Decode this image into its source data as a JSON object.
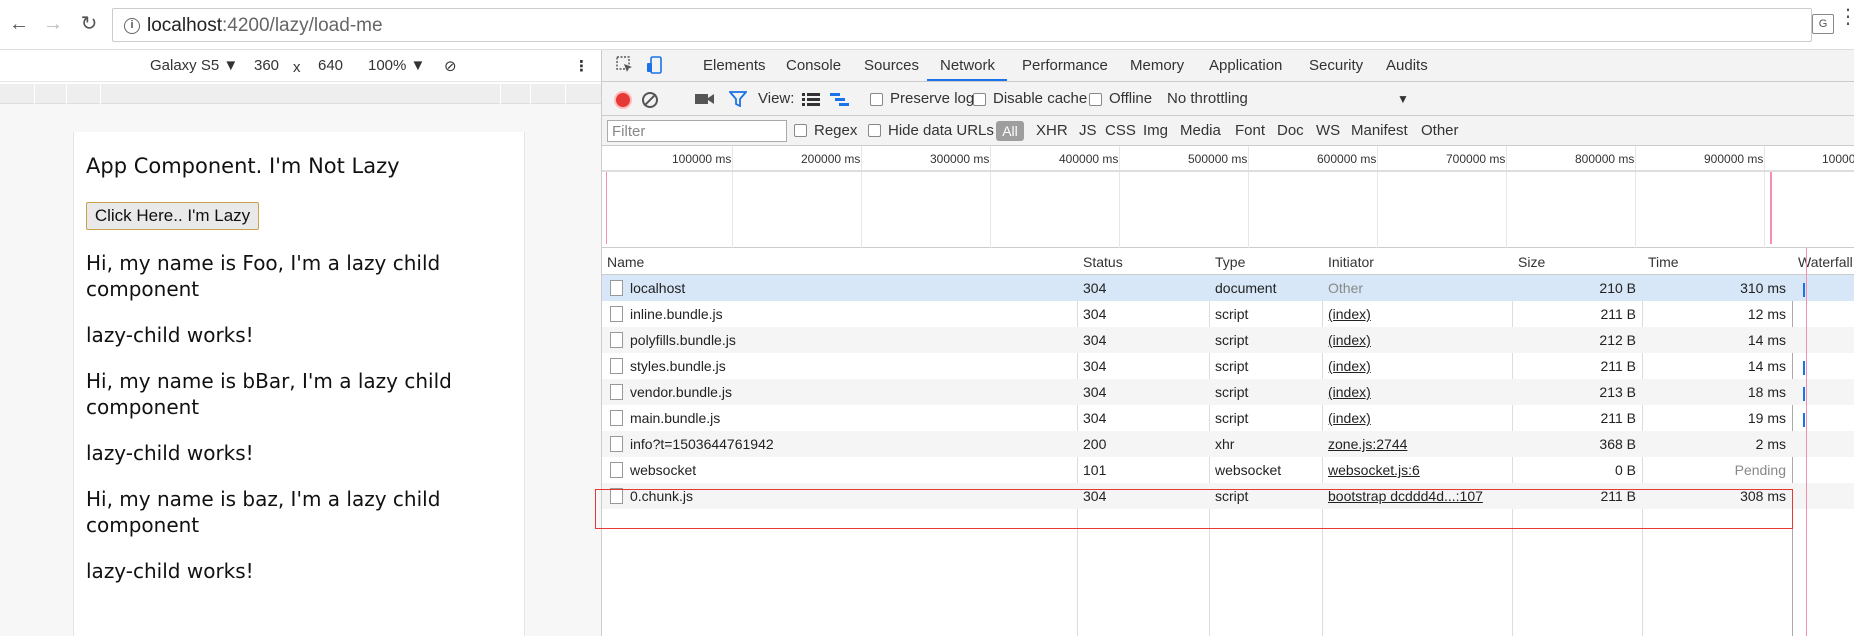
{
  "browser": {
    "url_host": "localhost",
    "url_rest": ":4200/lazy/load-me"
  },
  "device_toolbar": {
    "device": "Galaxy S5",
    "width": "360",
    "times": "x",
    "height": "640",
    "zoom": "100%"
  },
  "app": {
    "title": "App Component. I'm Not Lazy",
    "button_label": "Click Here.. I'm Lazy",
    "paragraphs": [
      "Hi, my name is Foo, I'm a lazy child component",
      "lazy-child works!",
      "Hi, my name is bBar, I'm a lazy child component",
      "lazy-child works!",
      "Hi, my name is baz, I'm a lazy child component",
      "lazy-child works!"
    ]
  },
  "devtools": {
    "tabs": [
      "Elements",
      "Console",
      "Sources",
      "Network",
      "Performance",
      "Memory",
      "Application",
      "Security",
      "Audits"
    ],
    "active_tab": "Network",
    "toolbar": {
      "view_label": "View:",
      "preserve_log": "Preserve log",
      "disable_cache": "Disable cache",
      "offline": "Offline",
      "throttling": "No throttling"
    },
    "filter": {
      "placeholder": "Filter",
      "regex": "Regex",
      "hide_data_urls": "Hide data URLs",
      "all": "All",
      "types": [
        "XHR",
        "JS",
        "CSS",
        "Img",
        "Media",
        "Font",
        "Doc",
        "WS",
        "Manifest",
        "Other"
      ]
    },
    "timeline_labels": [
      "100000 ms",
      "200000 ms",
      "300000 ms",
      "400000 ms",
      "500000 ms",
      "600000 ms",
      "700000 ms",
      "800000 ms",
      "900000 ms",
      "10000"
    ],
    "columns": [
      "Name",
      "Status",
      "Type",
      "Initiator",
      "Size",
      "Time",
      "Waterfall"
    ],
    "rows": [
      {
        "name": "localhost",
        "status": "304",
        "type": "document",
        "initiator": "Other",
        "size": "210 B",
        "time": "310 ms"
      },
      {
        "name": "inline.bundle.js",
        "status": "304",
        "type": "script",
        "initiator": "(index)",
        "size": "211 B",
        "time": "12 ms"
      },
      {
        "name": "polyfills.bundle.js",
        "status": "304",
        "type": "script",
        "initiator": "(index)",
        "size": "212 B",
        "time": "14 ms"
      },
      {
        "name": "styles.bundle.js",
        "status": "304",
        "type": "script",
        "initiator": "(index)",
        "size": "211 B",
        "time": "14 ms"
      },
      {
        "name": "vendor.bundle.js",
        "status": "304",
        "type": "script",
        "initiator": "(index)",
        "size": "213 B",
        "time": "18 ms"
      },
      {
        "name": "main.bundle.js",
        "status": "304",
        "type": "script",
        "initiator": "(index)",
        "size": "211 B",
        "time": "19 ms"
      },
      {
        "name": "info?t=1503644761942",
        "status": "200",
        "type": "xhr",
        "initiator": "zone.js:2744",
        "size": "368 B",
        "time": "2 ms"
      },
      {
        "name": "websocket",
        "status": "101",
        "type": "websocket",
        "initiator": "websocket.js:6",
        "size": "0 B",
        "time": "Pending"
      },
      {
        "name": "0.chunk.js",
        "status": "304",
        "type": "script",
        "initiator": "bootstrap dcddd4d...:107",
        "size": "211 B",
        "time": "308 ms"
      }
    ]
  }
}
